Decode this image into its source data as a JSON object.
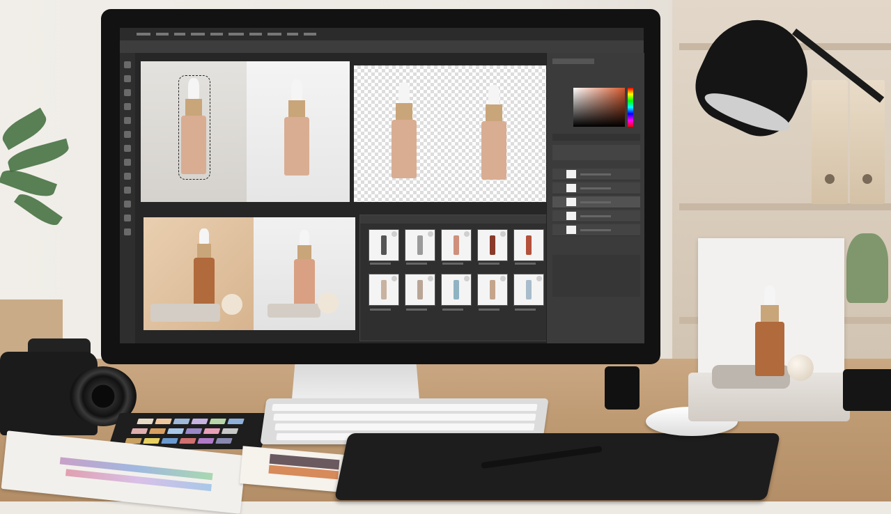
{
  "scene": {
    "description_kind": "photo of a product photographer's desk with an image editor on screen",
    "colors": {
      "serum": "#d9ad92",
      "amber": "#b06a3c",
      "gold_collar": "#c9a57a",
      "white_bulb": "#f5f5f5",
      "screen_dark": "#262626"
    }
  },
  "icons": [
    "camera-icon",
    "lamp-icon",
    "keyboard-icon",
    "mouse-icon",
    "pen-tablet-icon"
  ]
}
